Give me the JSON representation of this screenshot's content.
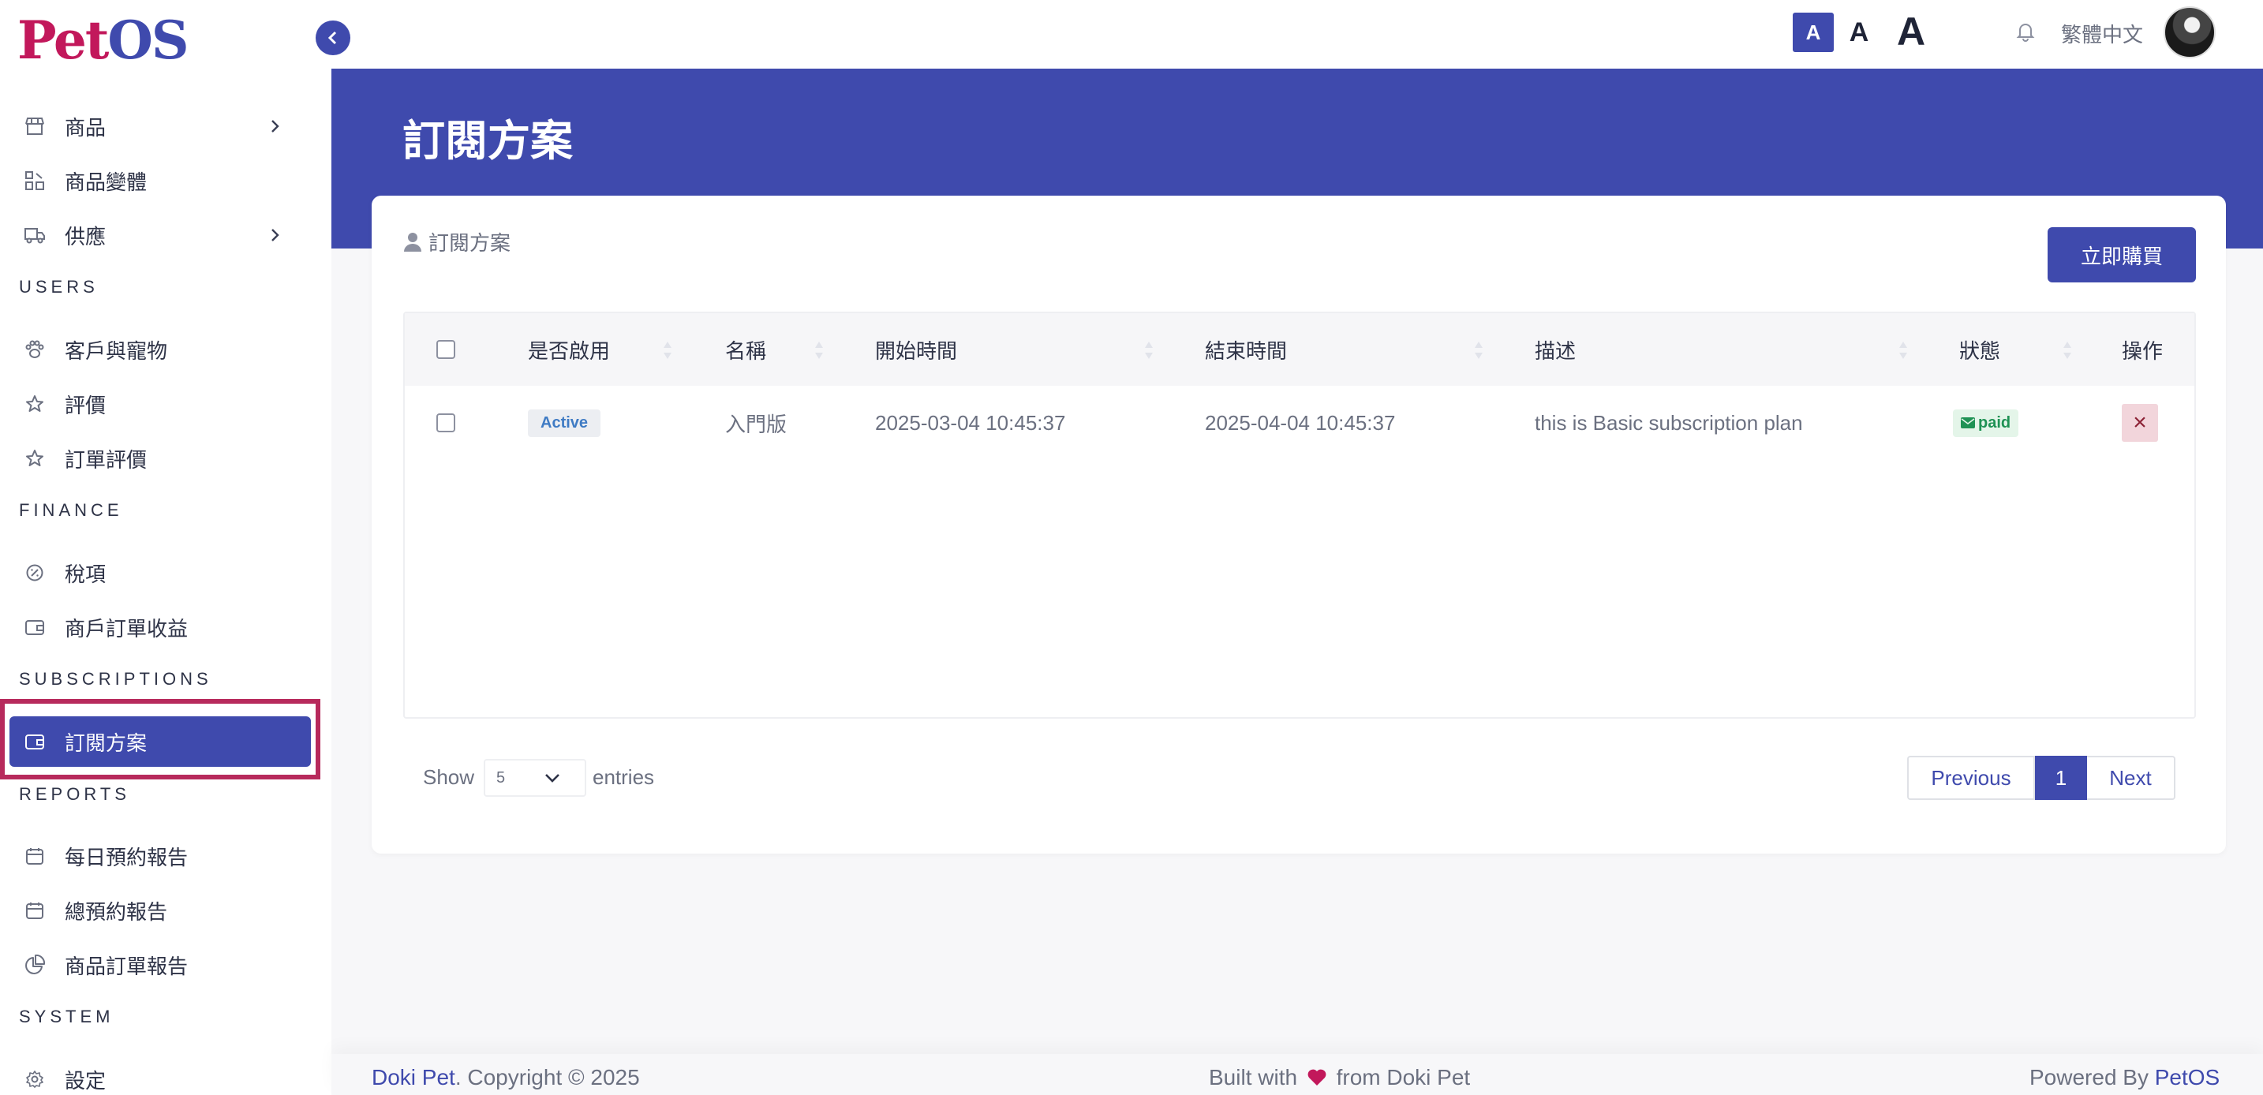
{
  "brand": {
    "logo_part1": "Pet",
    "logo_part2": "OS"
  },
  "sidebar": {
    "items": [
      {
        "label": "商品"
      },
      {
        "label": "商品變體"
      },
      {
        "label": "供應"
      },
      {
        "label": "客戶與寵物"
      },
      {
        "label": "評價"
      },
      {
        "label": "訂單評價"
      },
      {
        "label": "稅項"
      },
      {
        "label": "商戶訂單收益"
      },
      {
        "label": "訂閱方案"
      },
      {
        "label": "每日預約報告"
      },
      {
        "label": "總預約報告"
      },
      {
        "label": "商品訂單報告"
      },
      {
        "label": "設定"
      }
    ],
    "sections": [
      "USERS",
      "FINANCE",
      "SUBSCRIPTIONS",
      "REPORTS",
      "SYSTEM"
    ]
  },
  "topbar": {
    "font_small": "A",
    "font_medium": "A",
    "font_large": "A",
    "language": "繁體中文"
  },
  "page": {
    "title": "訂閱方案"
  },
  "card": {
    "heading": "訂閱方案",
    "buy_button": "立即購買",
    "columns": [
      "是否啟用",
      "名稱",
      "開始時間",
      "結束時間",
      "描述",
      "狀態",
      "操作"
    ],
    "rows": [
      {
        "enabled": "Active",
        "name": "入門版",
        "start": "2025-03-04 10:45:37",
        "end": "2025-04-04 10:45:37",
        "description": "this is Basic subscription plan",
        "status": "paid",
        "action": "×"
      }
    ],
    "show_label": "Show",
    "page_size": "5",
    "entries_label": "entries",
    "pagination": {
      "previous": "Previous",
      "current": "1",
      "next": "Next"
    }
  },
  "footer": {
    "left_brand": "Doki Pet",
    "left_text": ". Copyright © 2025",
    "center_before": "Built with",
    "center_after": "from Doki Pet",
    "right_text": "Powered By ",
    "right_brand": "PetOS"
  },
  "colors": {
    "primary": "#3f4aad",
    "accent": "#c2185b",
    "highlight_frame": "#b72a5c"
  }
}
